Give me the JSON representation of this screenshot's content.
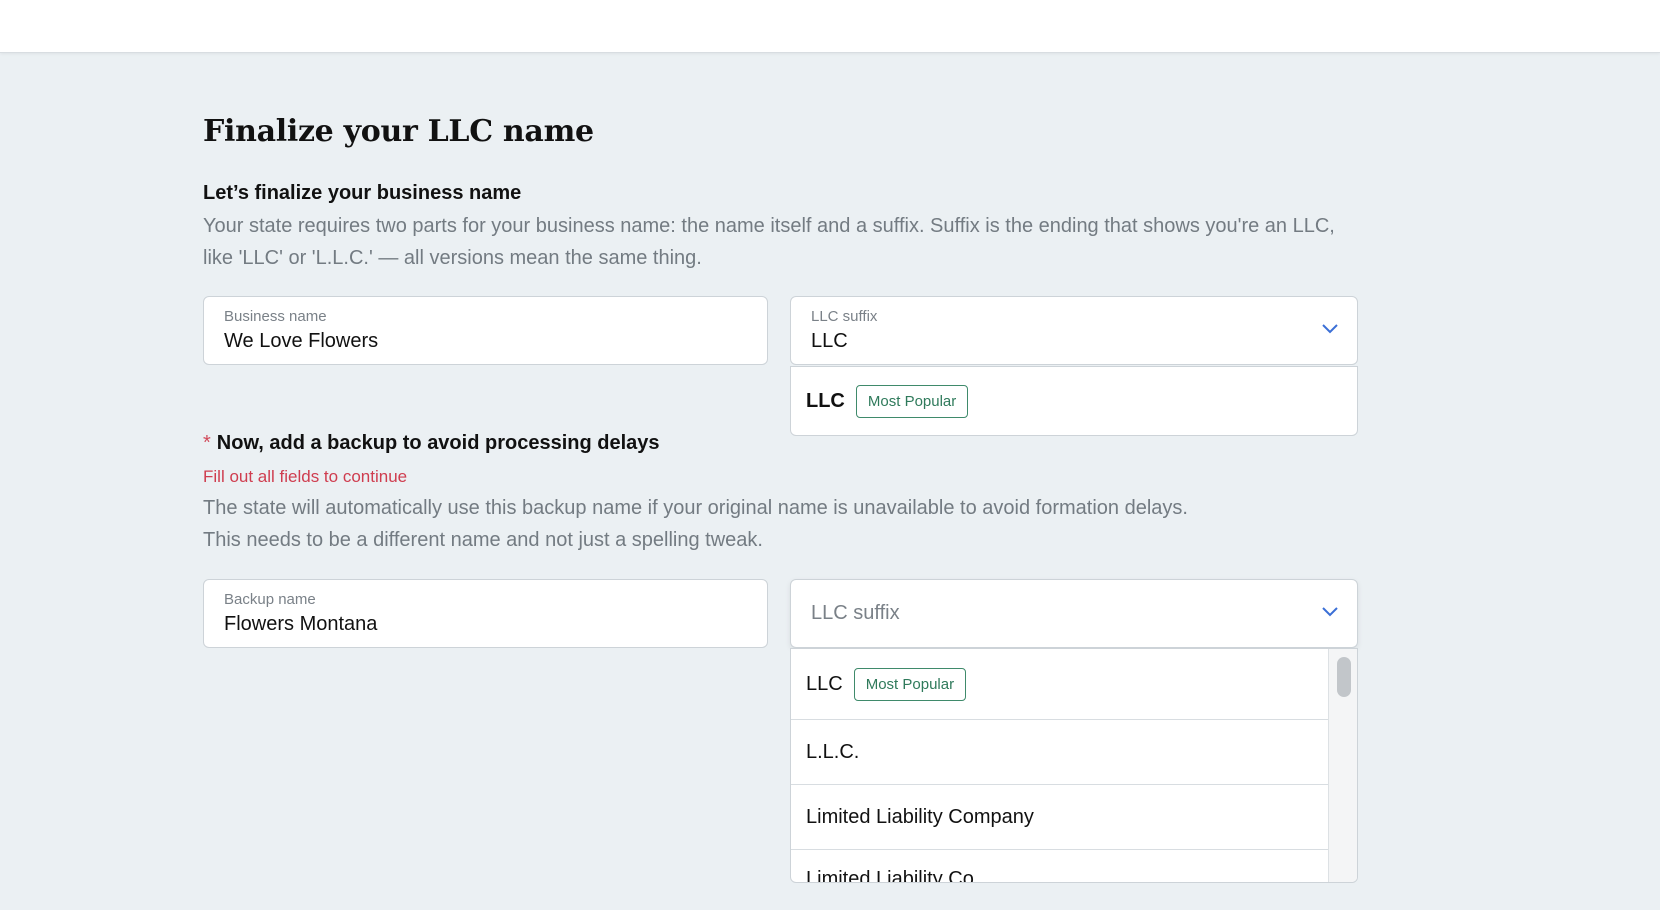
{
  "page": {
    "title": "Finalize your LLC name"
  },
  "business_section": {
    "heading": "Let’s finalize your business name",
    "description": "Your state requires two parts for your business name: the name itself and a suffix. Suffix is the ending that shows you're an LLC, like 'LLC' or 'L.L.C.' — all versions mean the same thing.",
    "name_field": {
      "label": "Business name",
      "value": "We Love Flowers"
    },
    "suffix_field": {
      "label": "LLC suffix",
      "value": "LLC"
    },
    "suffix_dropdown": {
      "options": [
        {
          "label": "LLC",
          "badge": "Most Popular"
        }
      ]
    }
  },
  "backup_section": {
    "required_marker": "*",
    "heading": "Now, add a backup to avoid processing delays",
    "error": "Fill out all fields to continue",
    "description_line1": "The state will automatically use this backup name if your original name is unavailable to avoid formation delays.",
    "description_line2": "This needs to be a different name and not just a spelling tweak.",
    "name_field": {
      "label": "Backup name",
      "value": "Flowers Montana"
    },
    "suffix_field": {
      "placeholder": "LLC suffix"
    },
    "suffix_dropdown": {
      "options": [
        {
          "label": "LLC",
          "badge": "Most Popular"
        },
        {
          "label": "L.L.C."
        },
        {
          "label": "Limited Liability Company"
        },
        {
          "label": "Limited Liability Co."
        }
      ]
    }
  },
  "colors": {
    "background": "#ebf0f3",
    "accent": "#3b6fd6",
    "badge": "#2f7a5b",
    "error": "#cf3d4f"
  },
  "icons": {
    "dropdown": "chevron-down-icon"
  }
}
